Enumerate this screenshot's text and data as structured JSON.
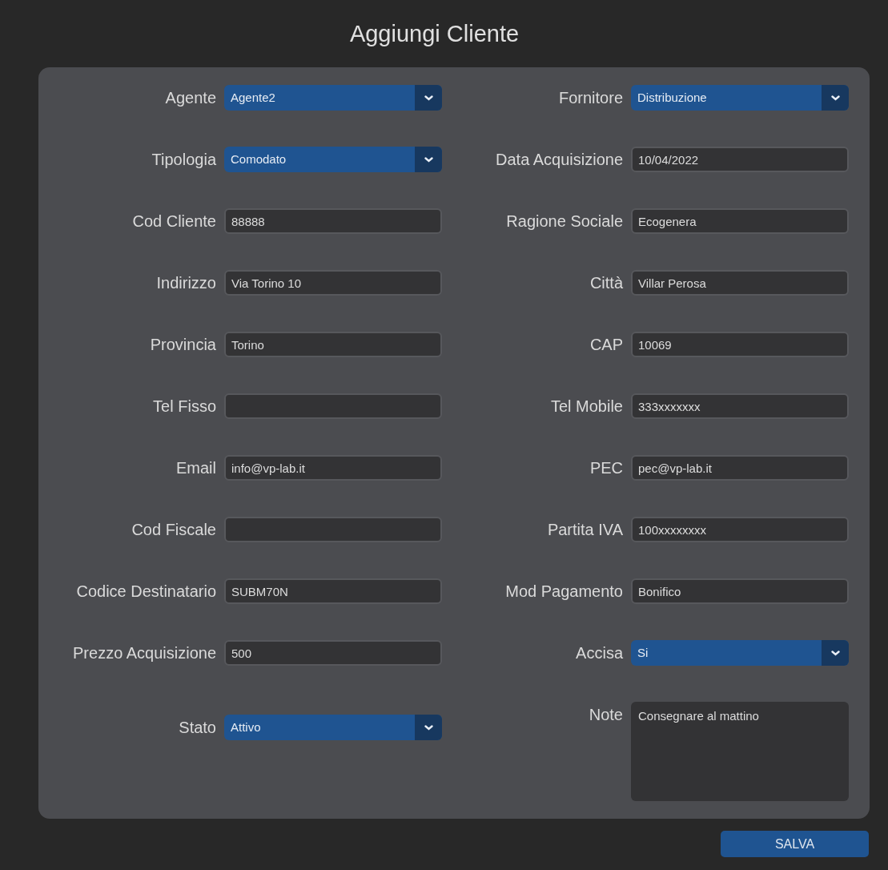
{
  "title": "Aggiungi Cliente",
  "fields": [
    {
      "label": "Agente",
      "kind": "select",
      "value": "Agente2"
    },
    {
      "label": "Fornitore",
      "kind": "select",
      "value": "Distribuzione"
    },
    {
      "label": "Tipologia",
      "kind": "select",
      "value": "Comodato"
    },
    {
      "label": "Data Acquisizione",
      "kind": "text",
      "value": "10/04/2022"
    },
    {
      "label": "Cod Cliente",
      "kind": "text",
      "value": "88888"
    },
    {
      "label": "Ragione Sociale",
      "kind": "text",
      "value": "Ecogenera"
    },
    {
      "label": "Indirizzo",
      "kind": "text",
      "value": "Via Torino 10"
    },
    {
      "label": "Città",
      "kind": "text",
      "value": "Villar Perosa"
    },
    {
      "label": "Provincia",
      "kind": "text",
      "value": "Torino"
    },
    {
      "label": "CAP",
      "kind": "text",
      "value": "10069"
    },
    {
      "label": "Tel Fisso",
      "kind": "text"
    },
    {
      "label": "Tel Mobile",
      "kind": "text",
      "value": "333xxxxxxx"
    },
    {
      "label": "Email",
      "kind": "text",
      "value": "info@vp-lab.it"
    },
    {
      "label": "PEC",
      "kind": "text",
      "value": "pec@vp-lab.it"
    },
    {
      "label": "Cod Fiscale",
      "kind": "text"
    },
    {
      "label": "Partita IVA",
      "kind": "text",
      "value": "100xxxxxxxx"
    },
    {
      "label": "Codice Destinatario",
      "kind": "text",
      "value": "SUBM70N"
    },
    {
      "label": "Mod Pagamento",
      "kind": "text",
      "value": "Bonifico"
    },
    {
      "label": "Prezzo Acquisizione",
      "kind": "text",
      "value": "500"
    },
    {
      "label": "Accisa",
      "kind": "select",
      "value": "Si"
    },
    {
      "label": "Stato",
      "kind": "select",
      "value": "Attivo"
    },
    {
      "label": "Note",
      "kind": "textarea",
      "value": "Consegnare al mattino"
    }
  ],
  "save_button": "SALVA"
}
